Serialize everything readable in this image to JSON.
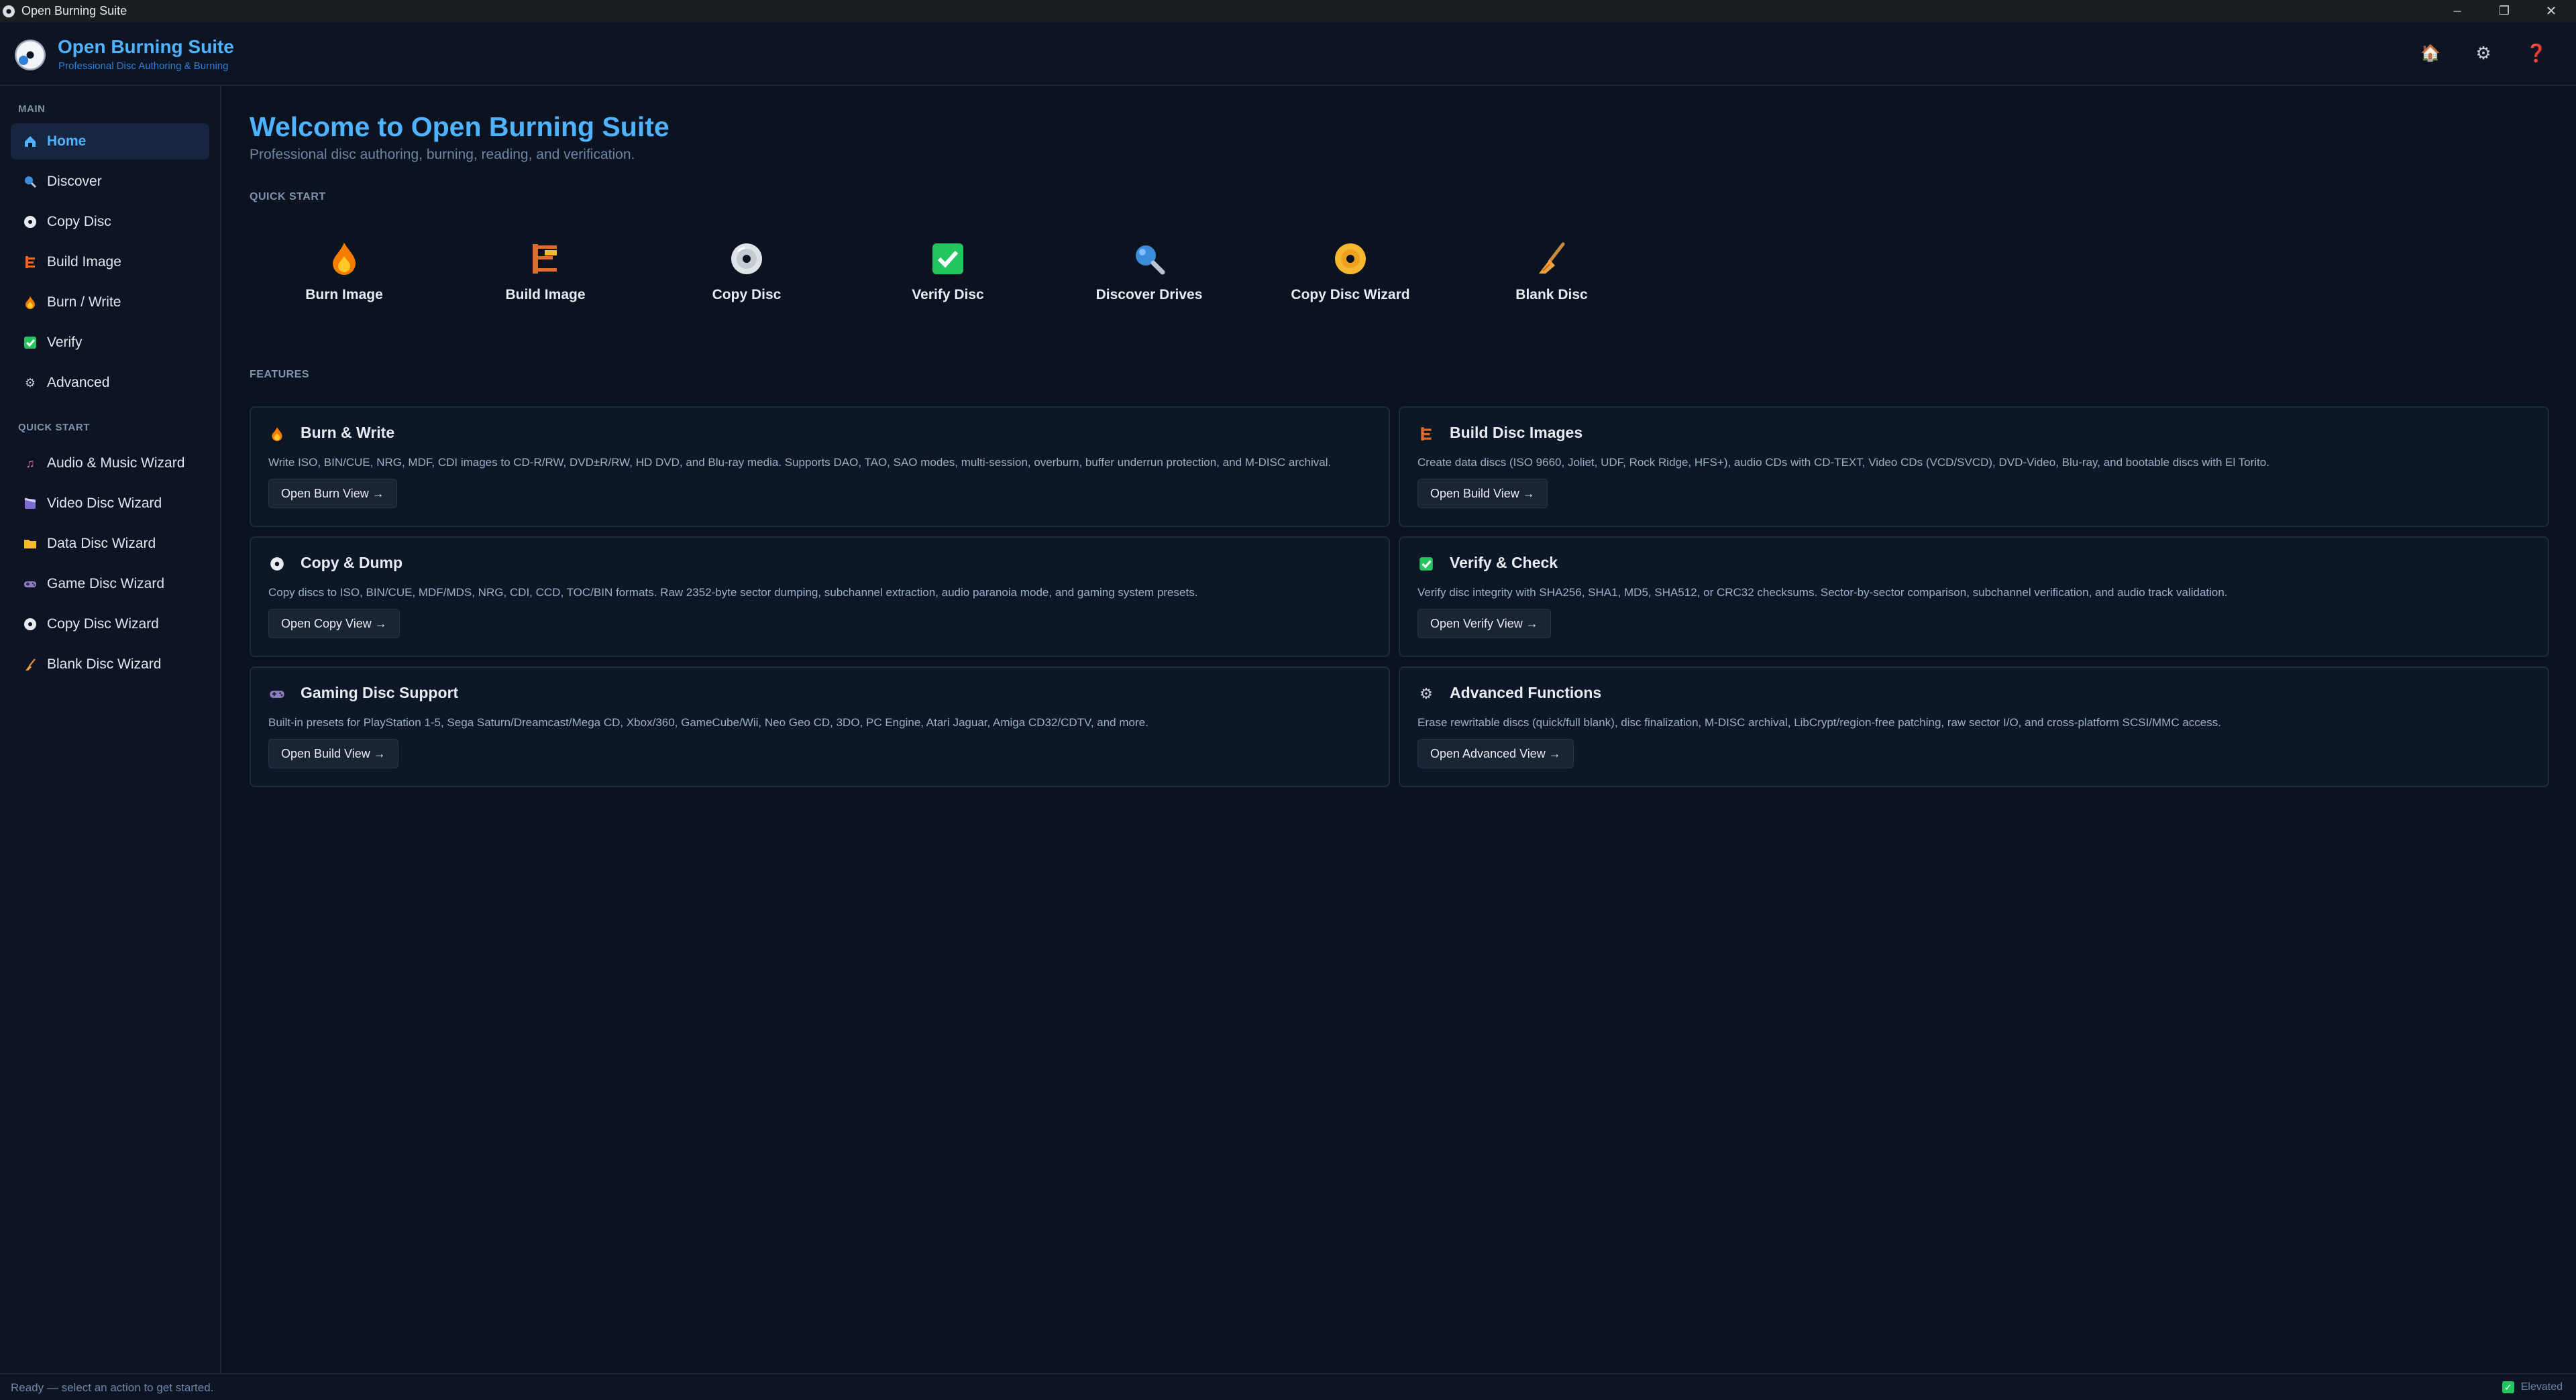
{
  "window": {
    "title": "Open Burning Suite",
    "minimize": "–",
    "restore": "❐",
    "close": "✕"
  },
  "header": {
    "title": "Open Burning Suite",
    "subtitle": "Professional Disc Authoring & Burning",
    "buttons": {
      "home": "🏠",
      "settings": "⚙",
      "help": "❓"
    }
  },
  "sidebar": {
    "main_label": "MAIN",
    "main_items": [
      {
        "label": "Home",
        "icon": "home-icon",
        "active": true
      },
      {
        "label": "Discover",
        "icon": "magnifier-icon"
      },
      {
        "label": "Copy Disc",
        "icon": "disc-icon"
      },
      {
        "label": "Build Image",
        "icon": "build-icon"
      },
      {
        "label": "Burn / Write",
        "icon": "flame-icon"
      },
      {
        "label": "Verify",
        "icon": "check-icon"
      },
      {
        "label": "Advanced",
        "icon": "gear-icon"
      }
    ],
    "quick_label": "QUICK START",
    "quick_items": [
      {
        "label": "Audio & Music Wizard",
        "icon": "music-note-icon"
      },
      {
        "label": "Video Disc Wizard",
        "icon": "film-icon"
      },
      {
        "label": "Data Disc Wizard",
        "icon": "folder-icon"
      },
      {
        "label": "Game Disc Wizard",
        "icon": "gamepad-icon"
      },
      {
        "label": "Copy Disc Wizard",
        "icon": "disc-icon"
      },
      {
        "label": "Blank Disc Wizard",
        "icon": "broom-icon"
      }
    ]
  },
  "main": {
    "title": "Welcome to Open Burning Suite",
    "subtitle": "Professional disc authoring, burning, reading, and verification.",
    "quick_start_label": "QUICK START",
    "quick_start": [
      {
        "label": "Burn Image",
        "icon": "flame-icon"
      },
      {
        "label": "Build Image",
        "icon": "build-icon"
      },
      {
        "label": "Copy Disc",
        "icon": "disc-icon"
      },
      {
        "label": "Verify Disc",
        "icon": "check-icon"
      },
      {
        "label": "Discover Drives",
        "icon": "magnifier-icon"
      },
      {
        "label": "Copy Disc Wizard",
        "icon": "dvd-icon"
      },
      {
        "label": "Blank Disc",
        "icon": "broom-icon"
      }
    ],
    "features_label": "FEATURES",
    "features": [
      {
        "title": "Burn & Write",
        "icon": "flame-icon",
        "desc": "Write ISO, BIN/CUE, NRG, MDF, CDI images to CD-R/RW, DVD±R/RW, HD DVD, and Blu-ray media. Supports DAO, TAO, SAO modes, multi-session, overburn, buffer underrun protection, and M-DISC archival.",
        "button": "Open Burn View →"
      },
      {
        "title": "Build Disc Images",
        "icon": "build-icon",
        "desc": "Create data discs (ISO 9660, Joliet, UDF, Rock Ridge, HFS+), audio CDs with CD-TEXT, Video CDs (VCD/SVCD), DVD-Video, Blu-ray, and bootable discs with El Torito.",
        "button": "Open Build View →"
      },
      {
        "title": "Copy & Dump",
        "icon": "disc-icon",
        "desc": "Copy discs to ISO, BIN/CUE, MDF/MDS, NRG, CDI, CCD, TOC/BIN formats. Raw 2352-byte sector dumping, subchannel extraction, audio paranoia mode, and gaming system presets.",
        "button": "Open Copy View →"
      },
      {
        "title": "Verify & Check",
        "icon": "check-icon",
        "desc": "Verify disc integrity with SHA256, SHA1, MD5, SHA512, or CRC32 checksums. Sector-by-sector comparison, subchannel verification, and audio track validation.",
        "button": "Open Verify View →"
      },
      {
        "title": "Gaming Disc Support",
        "icon": "gamepad-icon",
        "desc": "Built-in presets for PlayStation 1-5, Sega Saturn/Dreamcast/Mega CD, Xbox/360, GameCube/Wii, Neo Geo CD, 3DO, PC Engine, Atari Jaguar, Amiga CD32/CDTV, and more.",
        "button": "Open Build View →"
      },
      {
        "title": "Advanced Functions",
        "icon": "gear-icon",
        "desc": "Erase rewritable discs (quick/full blank), disc finalization, M-DISC archival, LibCrypt/region-free patching, raw sector I/O, and cross-platform SCSI/MMC access.",
        "button": "Open Advanced View →"
      }
    ]
  },
  "status": {
    "text": "Ready — select an action to get started.",
    "elevated": "Elevated"
  },
  "colors": {
    "accent": "#4fb3ff",
    "background": "#0b1220",
    "panel": "#0e1728",
    "success": "#22c55e"
  }
}
